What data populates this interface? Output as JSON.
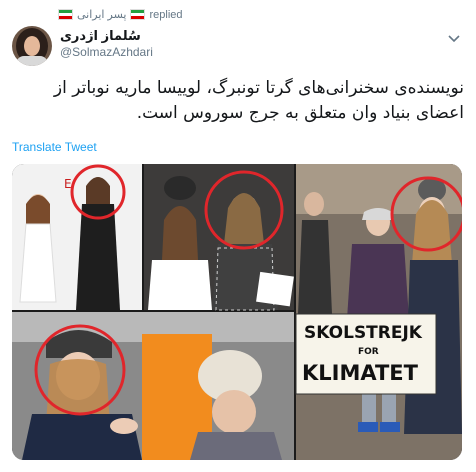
{
  "reply": {
    "label_before": "پسر ایرانی",
    "label_after": "replied"
  },
  "author": {
    "name": "سُلماز اژدری",
    "handle": "@SolmazAzhdari"
  },
  "tweet": {
    "text": "نویسنده‌ی سخنرانی‌های گرتا تونبرگ، لوییسا ماریه نوباتر  از اعضای بنیاد وان متعلق به جرج سوروس است."
  },
  "translate_link": "Translate Tweet",
  "image": {
    "sign_line1": "SKOLSTREJK",
    "sign_line2": "FOR",
    "sign_line3": "KLIMATET"
  },
  "colors": {
    "link": "#1da1f2",
    "highlight_circle": "#e0262b",
    "muted_text": "#657786"
  },
  "icons": [
    "iran-flag-icon",
    "chevron-down-icon"
  ]
}
